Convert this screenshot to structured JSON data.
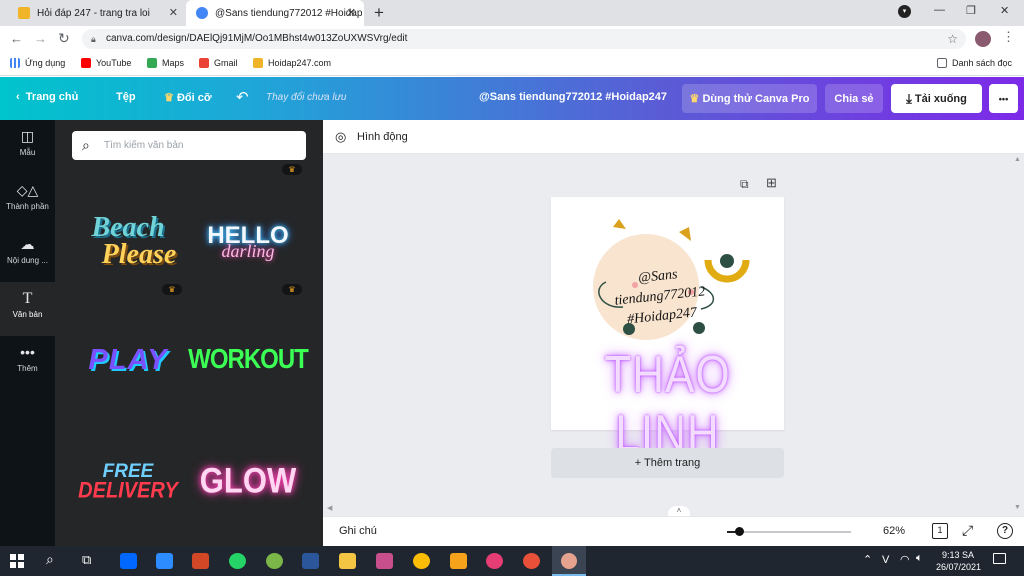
{
  "browser": {
    "tabs": [
      {
        "title": "Hỏi đáp 247 - trang tra loi",
        "active": false
      },
      {
        "title": "@Sans tiendung772012 #Hoidap",
        "active": true
      }
    ],
    "url": "canva.com/design/DAElQj91MjM/Oo1MBhst4w013ZoUXWSVrg/edit",
    "bookmarks": [
      "Ứng dụng",
      "YouTube",
      "Maps",
      "Gmail",
      "Hoidap247.com"
    ],
    "reading_list": "Danh sách đọc"
  },
  "header": {
    "home": "Trang chủ",
    "file": "Tệp",
    "resize": "Đổi cỡ",
    "unsaved": "Thay đổi chưa lưu",
    "doc_title": "@Sans tiendung772012 #Hoidap247",
    "try_pro": "Dùng thử Canva Pro",
    "share": "Chia sẻ",
    "download": "Tải xuống",
    "more": "•••"
  },
  "rail": [
    "Mẫu",
    "Thành phần",
    "Nội dung ...",
    "Văn bản",
    "Thêm"
  ],
  "panel": {
    "search_placeholder": "Tìm kiếm văn bản",
    "tiles": [
      {
        "line1": "Beach",
        "line2": "Please"
      },
      {
        "line1": "HELLO",
        "line2": "darling"
      },
      {
        "line1": "PLAY"
      },
      {
        "line1": "WORKOUT"
      },
      {
        "line1": "FREE",
        "line2": "DELIVERY"
      },
      {
        "line1": "GLOW"
      }
    ]
  },
  "toolbar": {
    "animate": "Hình động"
  },
  "design": {
    "circle_text": [
      "@Sans",
      "tiendung772012",
      "#Hoidap247"
    ],
    "headline": "THẢO LINH"
  },
  "add_page": "+ Thêm trang",
  "bottom": {
    "notes": "Ghi chú",
    "zoom": "62%",
    "page_count": "1",
    "help": "?",
    "zoom_level": 0.1
  },
  "taskbar": {
    "lang": "V",
    "time": "9:13 SA",
    "date": "26/07/2021"
  },
  "colors": {
    "brand_purple": "#7d2ae8",
    "brand_teal": "#00c4cc",
    "pro_crown": "#f5a623",
    "neon_pink": "#e879f9"
  }
}
